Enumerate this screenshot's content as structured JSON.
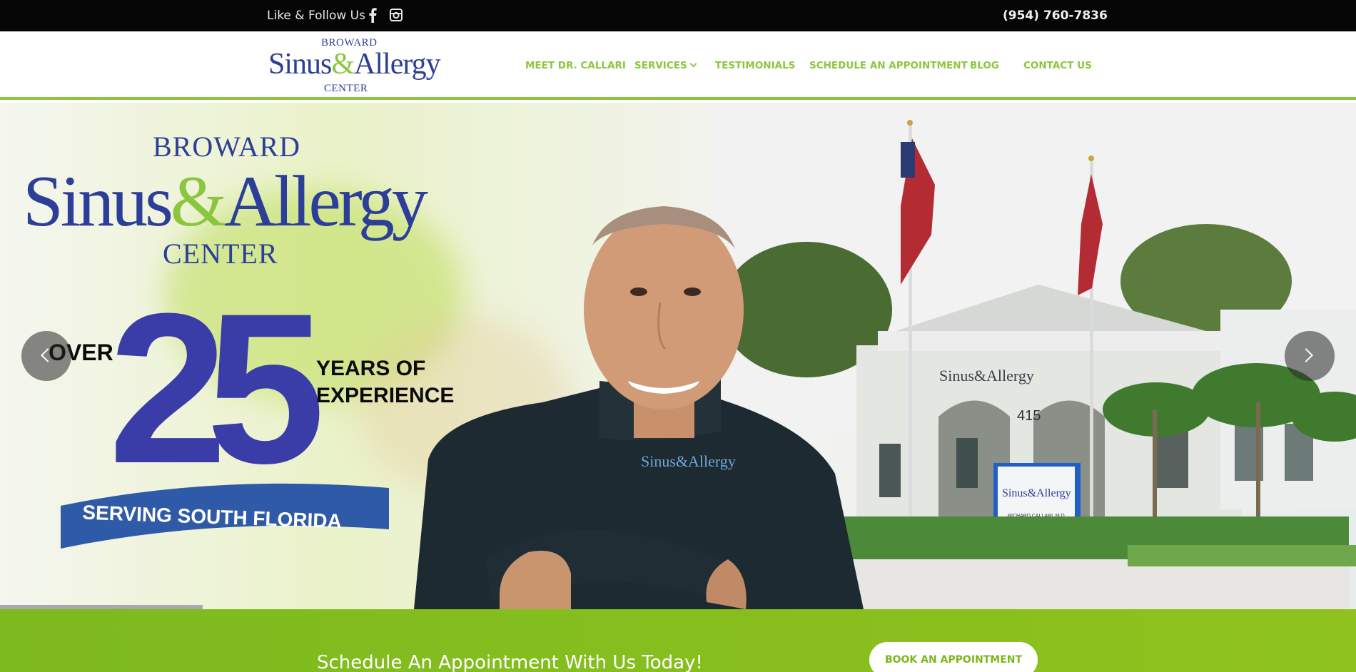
{
  "topbar": {
    "follow_label": "Like & Follow Us",
    "phone": "(954) 760-7836"
  },
  "header": {
    "logo": {
      "line1": "BROWARD",
      "line2_a": "Sinus",
      "line2_amp": "&",
      "line2_b": "Allergy",
      "line3": "CENTER"
    },
    "nav": [
      {
        "label": "MEET DR. CALLARI"
      },
      {
        "label": "SERVICES"
      },
      {
        "label": "TESTIMONIALS"
      },
      {
        "label": "SCHEDULE AN APPOINTMENT"
      },
      {
        "label": "BLOG"
      },
      {
        "label": "CONTACT US"
      }
    ]
  },
  "hero": {
    "brand_top": "BROWARD",
    "brand_a": "Sinus",
    "brand_amp": "&",
    "brand_b": "Allergy",
    "brand_bottom": "CENTER",
    "over": "OVER",
    "big_number": "25",
    "years_line1": "YEARS OF",
    "years_line2": "EXPERIENCE",
    "ribbon": "SERVING SOUTH FLORIDA",
    "shirt_logo": "Sinus&Allergy",
    "building_sign": "Sinus&Allergy",
    "monument_sign": "Sinus&Allergy",
    "monument_name": "RICHARD CALLARI, M.D.",
    "address_number": "415",
    "building_number": "415"
  },
  "cta": {
    "text": "Schedule An Appointment With Us Today!",
    "button": "BOOK AN APPOINTMENT"
  },
  "colors": {
    "brand_blue": "#2d3e98",
    "brand_green": "#8cc63f",
    "topbar": "#050505"
  }
}
